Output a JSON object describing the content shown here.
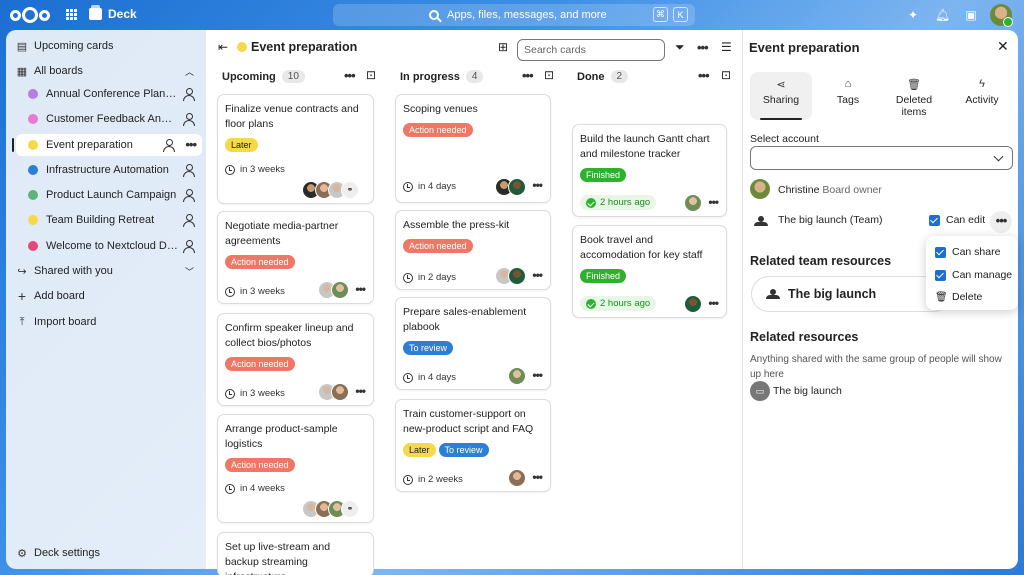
{
  "app": {
    "name": "Deck"
  },
  "search": {
    "placeholder": "Apps, files, messages, and more",
    "kbd1": "⌘",
    "kbd2": "K"
  },
  "sidebar": {
    "upcoming": "Upcoming cards",
    "all_boards": "All boards",
    "boards": [
      {
        "label": "Annual Conference Planni...",
        "color": "#b57ee0"
      },
      {
        "label": "Customer Feedback Analy...",
        "color": "#e87ad0"
      },
      {
        "label": "Event preparation",
        "color": "#f5d94a"
      },
      {
        "label": "Infrastructure Automation",
        "color": "#2d7ed6"
      },
      {
        "label": "Product Launch Campaign",
        "color": "#5fb37a"
      },
      {
        "label": "Team Building Retreat",
        "color": "#f5d94a"
      },
      {
        "label": "Welcome to Nextcloud De...",
        "color": "#e8457a"
      }
    ],
    "shared": "Shared with you",
    "add_board": "Add board",
    "import_board": "Import board",
    "settings": "Deck settings"
  },
  "board": {
    "title": "Event preparation",
    "color": "#f5d94a",
    "search_placeholder": "Search cards",
    "columns": [
      {
        "title": "Upcoming",
        "count": "10"
      },
      {
        "title": "In progress",
        "count": "4"
      },
      {
        "title": "Done",
        "count": "2"
      }
    ],
    "cards": {
      "c1": {
        "title": "Finalize venue contracts and floor plans",
        "tag": "Later",
        "due": "in 3 weeks"
      },
      "c2": {
        "title": "Negotiate media-partner agreements",
        "tag": "Action needed",
        "due": "in 3 weeks"
      },
      "c3": {
        "title": "Confirm speaker lineup and collect bios/photos",
        "tag": "Action needed",
        "due": "in 3 weeks"
      },
      "c4": {
        "title": "Arrange product-sample logistics",
        "tag": "Action needed",
        "due": "in 4 weeks"
      },
      "c5": {
        "title": "Set up live-stream and backup streaming infrastructure"
      },
      "p1": {
        "title": "Scoping venues",
        "tag": "Action needed",
        "due": "in 4 days"
      },
      "p2": {
        "title": "Assemble the press-kit",
        "tag": "Action needed",
        "due": "in 2 days"
      },
      "p3": {
        "title": "Prepare sales-enablement plabook",
        "tag": "To review",
        "due": "in 4 days"
      },
      "p4": {
        "title": "Train customer-support on new-product script and FAQ",
        "tag": "Later",
        "tag2": "To review",
        "due": "in 2 weeks"
      },
      "d1": {
        "title": "Build the launch Gantt chart and milestone tracker",
        "tag": "Finished",
        "due": "2 hours ago"
      },
      "d2": {
        "title": "Book travel and accomodation for key staff",
        "tag": "Finished",
        "due": "2 hours ago"
      }
    }
  },
  "panel": {
    "title": "Event preparation",
    "tabs": [
      "Sharing",
      "Tags",
      "Deleted items",
      "Activity"
    ],
    "select_label": "Select account",
    "owner_name": "Christine",
    "owner_role": "Board owner",
    "team_name": "The big launch (Team)",
    "can_edit": "Can edit",
    "menu": {
      "share": "Can share",
      "manage": "Can manage",
      "delete": "Delete"
    },
    "related_team": "Related team resources",
    "team_button": "The big launch",
    "related_resources": "Related resources",
    "related_desc": "Anything shared with the same group of people will show up here",
    "resource_name": "The big launch"
  }
}
